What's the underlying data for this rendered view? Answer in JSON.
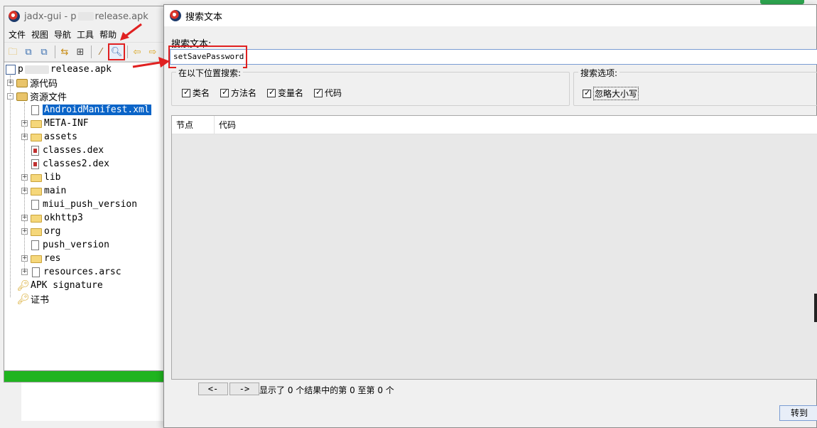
{
  "main_window": {
    "title_prefix": "jadx-gui - p",
    "title_suffix": "release.apk",
    "menu": [
      "文件",
      "视图",
      "导航",
      "工具",
      "帮助"
    ],
    "toolbar_icons": [
      "open-folder-icon",
      "copy-icon",
      "save-all-icon",
      "sync-icon",
      "expand-icon",
      "wand-icon",
      "search-icon",
      "back-icon",
      "forward-icon"
    ],
    "tree": {
      "root": {
        "prefix": "p",
        "suffix": "release.apk"
      },
      "items": [
        {
          "label": "源代码",
          "icon": "package-icon",
          "expand": "+"
        },
        {
          "label": "资源文件",
          "icon": "jar-icon",
          "expand": "-"
        },
        {
          "label": "AndroidManifest.xml",
          "icon": "file-icon",
          "selected": true
        },
        {
          "label": "META-INF",
          "icon": "folder-icon",
          "expand": "+"
        },
        {
          "label": "assets",
          "icon": "folder-icon",
          "expand": "+"
        },
        {
          "label": "classes.dex",
          "icon": "dex-icon"
        },
        {
          "label": "classes2.dex",
          "icon": "dex-icon"
        },
        {
          "label": "lib",
          "icon": "folder-icon",
          "expand": "+"
        },
        {
          "label": "main",
          "icon": "folder-icon",
          "expand": "+"
        },
        {
          "label": "miui_push_version",
          "icon": "file-icon"
        },
        {
          "label": "okhttp3",
          "icon": "folder-icon",
          "expand": "+"
        },
        {
          "label": "org",
          "icon": "folder-icon",
          "expand": "+"
        },
        {
          "label": "push_version",
          "icon": "file-icon"
        },
        {
          "label": "res",
          "icon": "folder-icon",
          "expand": "+"
        },
        {
          "label": "resources.arsc",
          "icon": "file-icon",
          "expand": "+"
        },
        {
          "label": "APK signature",
          "icon": "key-icon"
        },
        {
          "label": "证书",
          "icon": "key-icon"
        }
      ]
    }
  },
  "search_dialog": {
    "title": "搜索文本",
    "search_label": "搜索文本:",
    "search_value": "setSavePassword",
    "location_group": {
      "label": "在以下位置搜索:",
      "options": [
        {
          "label": "类名",
          "checked": true
        },
        {
          "label": "方法名",
          "checked": true
        },
        {
          "label": "变量名",
          "checked": true
        },
        {
          "label": "代码",
          "checked": true
        }
      ]
    },
    "options_group": {
      "label": "搜索选项:",
      "options": [
        {
          "label": "忽略大小写",
          "checked": true
        }
      ]
    },
    "columns": [
      "节点",
      "代码"
    ],
    "prev_label": "<-",
    "next_label": "->",
    "status": "显示了 0 个结果中的第 0 至第 0 个",
    "goto_label": "转到"
  },
  "colors": {
    "highlight_red": "#e02020",
    "selection_blue": "#0a64c8",
    "progress_green": "#1fb41f"
  }
}
